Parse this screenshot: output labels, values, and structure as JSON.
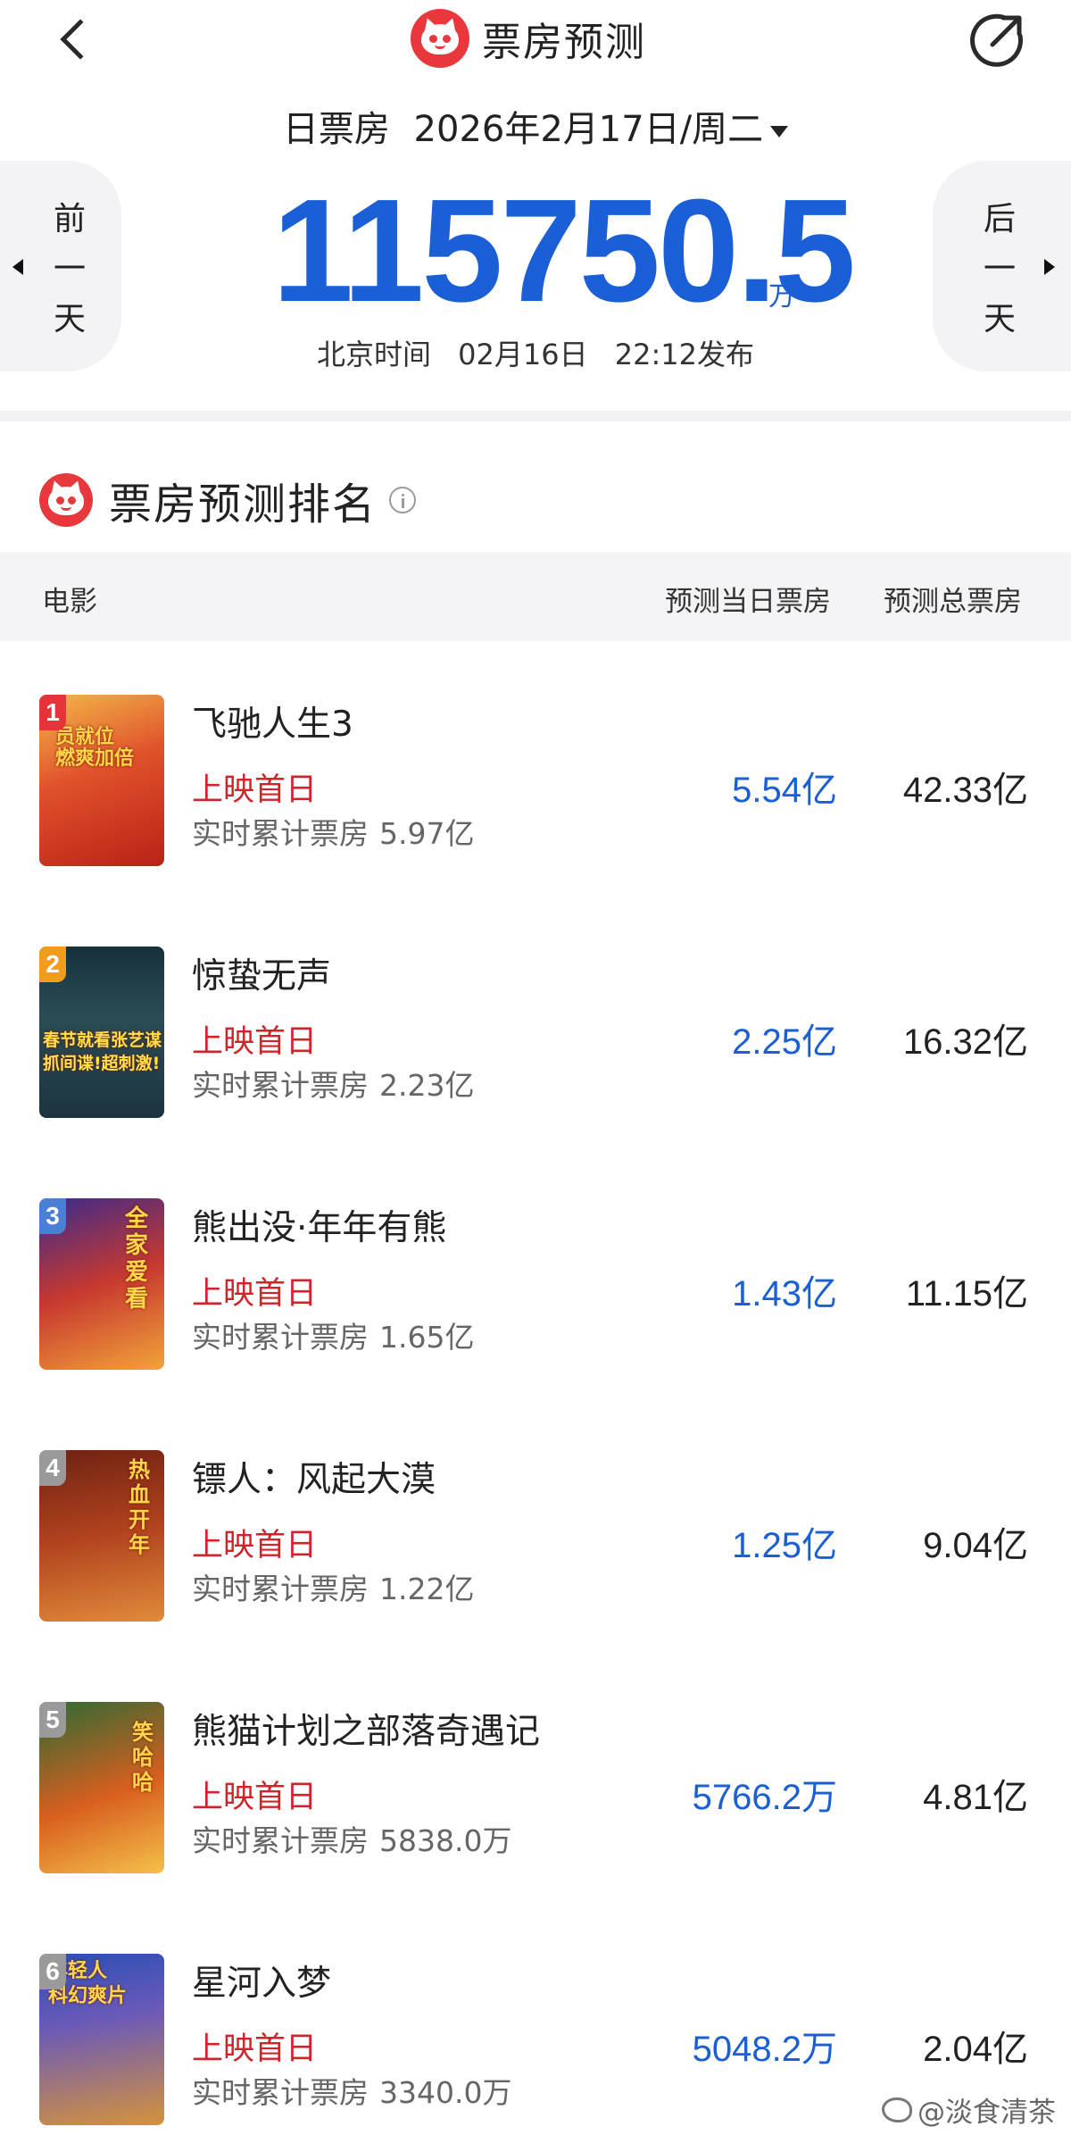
{
  "header": {
    "title": "票房预测"
  },
  "date_selector": {
    "label": "日票房",
    "date": "2026年2月17日/周二"
  },
  "nav": {
    "prev_label": "前\n一\n天",
    "next_label": "后\n一\n天"
  },
  "total": {
    "value": "115750.5",
    "unit": "万"
  },
  "publish": {
    "prefix": "北京时间",
    "date": "02月16日",
    "time": "22:12发布"
  },
  "ranking": {
    "title": "票房预测排名",
    "columns": {
      "movie": "电影",
      "day": "预测当日票房",
      "total": "预测总票房"
    },
    "rows": [
      {
        "rank": "1",
        "name": "飞驰人生3",
        "status": "上映首日",
        "cum_label": "实时累计票房",
        "cum_value": "5.97亿",
        "day_value": "5.54",
        "day_unit": "亿",
        "total_value": "42.33",
        "total_unit": "亿",
        "poster_text": "员就位\n燃爽加倍"
      },
      {
        "rank": "2",
        "name": "惊蛰无声",
        "status": "上映首日",
        "cum_label": "实时累计票房",
        "cum_value": "2.23亿",
        "day_value": "2.25",
        "day_unit": "亿",
        "total_value": "16.32",
        "total_unit": "亿",
        "poster_text": "春节就看张艺谋\n抓间谍!超刺激!"
      },
      {
        "rank": "3",
        "name": "熊出没·年年有熊",
        "status": "上映首日",
        "cum_label": "实时累计票房",
        "cum_value": "1.65亿",
        "day_value": "1.43",
        "day_unit": "亿",
        "total_value": "11.15",
        "total_unit": "亿",
        "poster_text": "全家\n爱看"
      },
      {
        "rank": "4",
        "name": "镖人：风起大漠",
        "status": "上映首日",
        "cum_label": "实时累计票房",
        "cum_value": "1.22亿",
        "day_value": "1.25",
        "day_unit": "亿",
        "total_value": "9.04",
        "total_unit": "亿",
        "poster_text": "热血开年"
      },
      {
        "rank": "5",
        "name": "熊猫计划之部落奇遇记",
        "status": "上映首日",
        "cum_label": "实时累计票房",
        "cum_value": "5838.0万",
        "day_value": "5766.2",
        "day_unit": "万",
        "total_value": "4.81",
        "total_unit": "亿",
        "poster_text": "笑哈哈"
      },
      {
        "rank": "6",
        "name": "星河入梦",
        "status": "上映首日",
        "cum_label": "实时累计票房",
        "cum_value": "3340.0万",
        "day_value": "5048.2",
        "day_unit": "万",
        "total_value": "2.04",
        "total_unit": "亿",
        "poster_text": "年轻人\n科幻爽片"
      }
    ]
  },
  "watermark": "@淡食清茶",
  "icons": {
    "back": "chevron-left-icon",
    "share": "share-icon",
    "logo": "cat-logo-icon",
    "info": "info-icon",
    "dropdown": "caret-down-icon"
  },
  "colors": {
    "accent_blue": "#1a5fd6",
    "status_red": "#d2232a",
    "logo_red": "#e8383b",
    "rank_colors": [
      "#e5333a",
      "#f29c1e",
      "#4a7fd6",
      "#9a9a9a",
      "#9a9a9a",
      "#9a9a9a"
    ]
  }
}
